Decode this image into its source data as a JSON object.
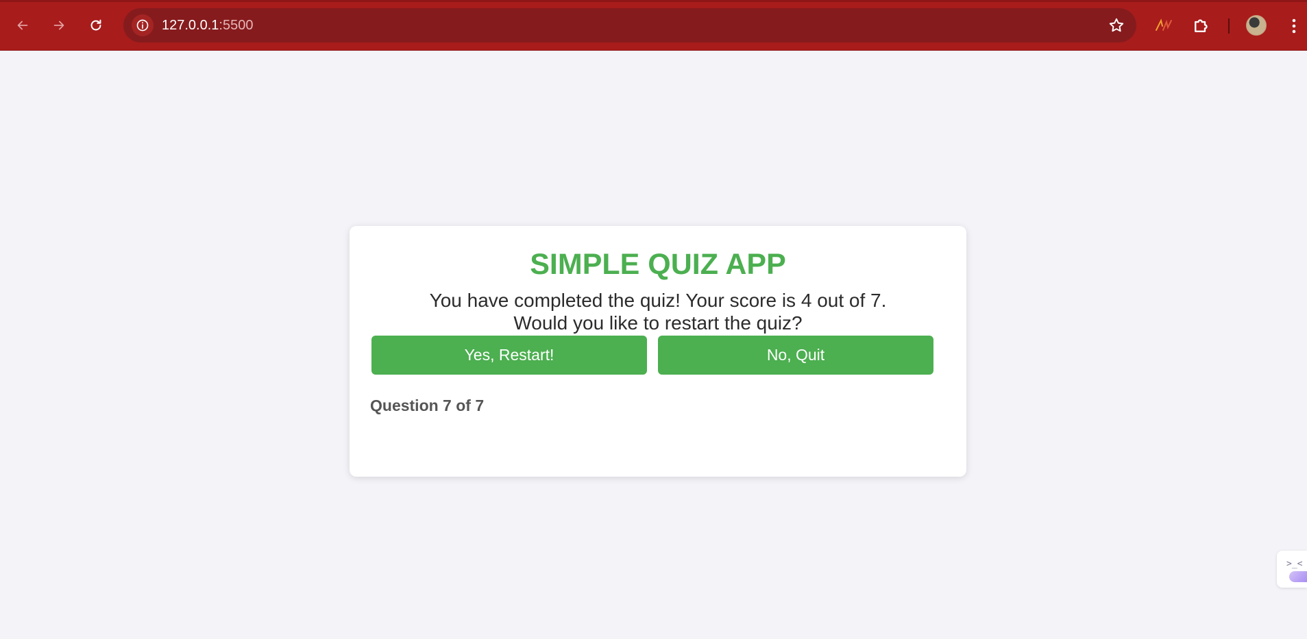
{
  "browser": {
    "url_host": "127.0.0.1",
    "url_port": ":5500",
    "icons": {
      "back": "arrow-left-icon",
      "forward": "arrow-right-icon",
      "reload": "reload-icon",
      "site_info": "info-icon",
      "bookmark": "star-icon",
      "extension_ai": "ai-extension-icon",
      "extensions": "puzzle-icon",
      "profile": "avatar",
      "menu": "kebab-menu-icon"
    },
    "colors": {
      "toolbar": "#a81c1c",
      "omnibox": "#861b1d"
    }
  },
  "quiz": {
    "title": "SIMPLE QUIZ APP",
    "message_line1": "You have completed the quiz! Your score is 4 out of 7.",
    "message_line2": "Would you like to restart the quiz?",
    "restart_label": "Yes, Restart!",
    "quit_label": "No, Quit",
    "counter": "Question 7 of 7",
    "colors": {
      "accent": "#4caf50",
      "card": "#ffffff",
      "page_bg": "#f3f3f8"
    }
  },
  "side_widget": {
    "face": ">_<"
  }
}
